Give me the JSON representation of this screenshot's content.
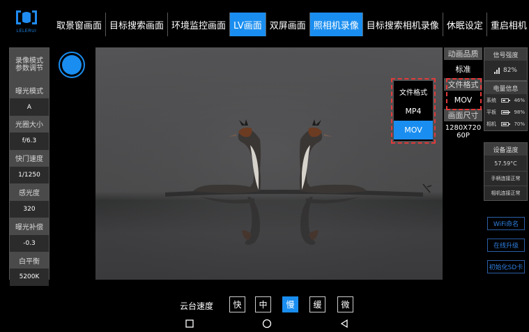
{
  "app": {
    "brand": "LELERUI"
  },
  "top_tabs": [
    {
      "label": "取景窗画面"
    },
    {
      "label": "目标搜索画面"
    },
    {
      "label": "环境监控画面"
    },
    {
      "label": "LV画面"
    },
    {
      "label": "双屏画面"
    },
    {
      "label": "照相机录像"
    },
    {
      "label": "目标搜索相机录像"
    },
    {
      "label": "休眠设定"
    },
    {
      "label": "重启相机"
    }
  ],
  "active_tabs": [
    "LV画面",
    "照相机录像"
  ],
  "left_panel": {
    "header_line1": "录像模式",
    "header_line2": "参数调节",
    "items": [
      {
        "label": "曝光模式",
        "value": "A"
      },
      {
        "label": "光圈大小",
        "value": "f/6.3"
      },
      {
        "label": "快门速度",
        "value": "1/1250"
      },
      {
        "label": "感光度",
        "value": "320"
      },
      {
        "label": "曝光补偿",
        "value": "-0.3"
      },
      {
        "label": "白平衡",
        "value": "5200K"
      }
    ]
  },
  "format_popup": {
    "title": "文件格式",
    "options": [
      "MP4",
      "MOV"
    ],
    "selected": "MOV"
  },
  "video_settings": {
    "quality_label": "动画品质",
    "quality_value": "标准",
    "format_label": "文件格式",
    "format_value": "MOV",
    "size_label": "画面尺寸",
    "size_value_line1": "1280X720",
    "size_value_line2": "60P"
  },
  "status": {
    "signal_label": "信号强度",
    "signal_value": "82%",
    "battery_label": "电量信息",
    "batteries": [
      {
        "name": "系统",
        "value": "46%",
        "level": 0.46
      },
      {
        "name": "平板",
        "value": "98%",
        "level": 0.98
      },
      {
        "name": "相机",
        "value": "70%",
        "level": 0.7
      }
    ],
    "temp_label": "设备温度",
    "temp_value": "57.59°C",
    "handle_status": "手柄连接正常",
    "camera_status": "相机连接正常"
  },
  "actions": {
    "wifi": "WiFi命名",
    "upgrade": "在线升级",
    "format_sd": "初始化SD卡"
  },
  "gimbal": {
    "label": "云台速度",
    "options": [
      "快",
      "中",
      "慢",
      "缓",
      "微"
    ],
    "selected": "慢"
  },
  "colors": {
    "accent": "#1a8ef0",
    "highlight_frame": "#e23a3a"
  },
  "icons": {
    "record": "record-icon",
    "signal": "signal-icon",
    "battery": "battery-icon",
    "nav": [
      "recent-apps-icon",
      "home-icon",
      "back-icon"
    ]
  }
}
